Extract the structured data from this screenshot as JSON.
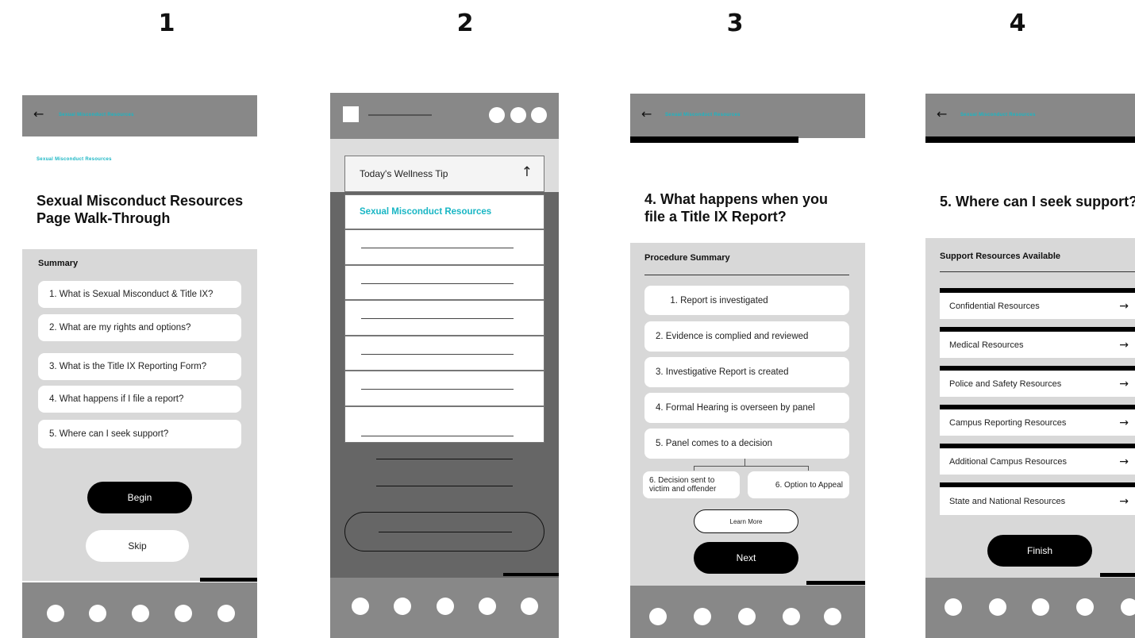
{
  "labels": {
    "s1": "1",
    "s2": "2",
    "s3": "3",
    "s4": "4"
  },
  "icons": {
    "back": "←",
    "up": "↑",
    "right": "→"
  },
  "screen1": {
    "top_link": "Sexual Misconduct Resources",
    "section_link": "Sexual Misconduct Resources",
    "title_line1": "Sexual Misconduct Resources",
    "title_line2": "Page Walk-Through",
    "summary_label": "Summary",
    "items": [
      "1. What is Sexual Misconduct & Title IX?",
      "2. What are my rights and options?",
      "3. What is the Title IX Reporting Form?",
      "4. What happens if I file a report?",
      "5. Where can I seek support?"
    ],
    "begin": "Begin",
    "skip": "Skip"
  },
  "screen2": {
    "wellness_tip": "Today's Wellness Tip",
    "menu_item": "Sexual Misconduct Resources"
  },
  "screen3": {
    "top_link": "Sexual Misconduct Resources",
    "title_line1": "4. What happens when you",
    "title_line2": "file a Title IX Report?",
    "summary_label": "Procedure Summary",
    "steps": [
      "1. Report is investigated",
      "2. Evidence is complied and reviewed",
      "3. Investigative Report is created",
      "4. Formal Hearing is overseen by panel",
      "5. Panel comes to a decision"
    ],
    "branch_left_1": "6. Decision sent to",
    "branch_left_2": "victim and offender",
    "branch_right": "6. Option to Appeal",
    "learn_more": "Learn More",
    "next": "Next"
  },
  "screen4": {
    "top_link": "Sexual Misconduct Resources",
    "title": "5. Where can I seek support?",
    "summary_label": "Support Resources Available",
    "resources": [
      "Confidential Resources",
      "Medical Resources",
      "Police and Safety Resources",
      "Campus Reporting Resources",
      "Additional Campus Resources",
      "State and National Resources"
    ],
    "finish": "Finish"
  }
}
